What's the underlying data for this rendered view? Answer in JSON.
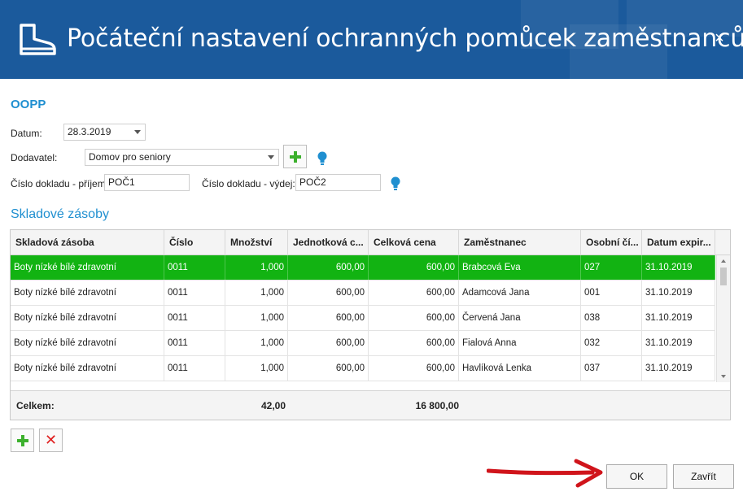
{
  "dialog": {
    "title": "Počáteční nastavení ochranných pomůcek zaměstnancům",
    "close_glyph": "×"
  },
  "oopp": {
    "heading": "OOPP",
    "datum_label": "Datum:",
    "datum_value": "28.3.2019",
    "dodavatel_label": "Dodavatel:",
    "dodavatel_value": "Domov pro seniory",
    "doklad_prijem_label": "Číslo dokladu - příjem:",
    "doklad_prijem_value": "POČ1",
    "doklad_vydej_label": "Číslo dokladu - výdej:",
    "doklad_vydej_value": "POČ2"
  },
  "sklad": {
    "heading": "Skladové zásoby",
    "columns": [
      "Skladová zásoba",
      "Číslo",
      "Množství",
      "Jednotková c...",
      "Celková cena",
      "Zaměstnanec",
      "Osobní čí...",
      "Datum expir..."
    ],
    "rows": [
      {
        "zasoba": "Boty nízké bílé zdravotní",
        "cislo": "0011",
        "mnozstvi": "1,000",
        "jednotkova": "600,00",
        "celkova": "600,00",
        "zamestnanec": "Brabcová Eva",
        "osobni": "027",
        "datum": "31.10.2019",
        "selected": true
      },
      {
        "zasoba": "Boty nízké bílé zdravotní",
        "cislo": "0011",
        "mnozstvi": "1,000",
        "jednotkova": "600,00",
        "celkova": "600,00",
        "zamestnanec": "Adamcová Jana",
        "osobni": "001",
        "datum": "31.10.2019",
        "selected": false
      },
      {
        "zasoba": "Boty nízké bílé zdravotní",
        "cislo": "0011",
        "mnozstvi": "1,000",
        "jednotkova": "600,00",
        "celkova": "600,00",
        "zamestnanec": "Červená Jana",
        "osobni": "038",
        "datum": "31.10.2019",
        "selected": false
      },
      {
        "zasoba": "Boty nízké bílé zdravotní",
        "cislo": "0011",
        "mnozstvi": "1,000",
        "jednotkova": "600,00",
        "celkova": "600,00",
        "zamestnanec": "Fialová Anna",
        "osobni": "032",
        "datum": "31.10.2019",
        "selected": false
      },
      {
        "zasoba": "Boty nízké bílé zdravotní",
        "cislo": "0011",
        "mnozstvi": "1,000",
        "jednotkova": "600,00",
        "celkova": "600,00",
        "zamestnanec": "Havlíková Lenka",
        "osobni": "037",
        "datum": "31.10.2019",
        "selected": false
      }
    ],
    "footer": {
      "label": "Celkem:",
      "mnozstvi_total": "42,00",
      "celkova_total": "16 800,00"
    }
  },
  "buttons": {
    "ok": "OK",
    "close": "Zavřít"
  },
  "icons": {
    "header": "boot-icon",
    "add": "plus-icon",
    "remove": "x-icon",
    "hint": "lightbulb-icon"
  },
  "colors": {
    "header_bg": "#1b5a9c",
    "accent": "#1f8fd0",
    "selected_row": "#12b312",
    "plus": "#3cb02d",
    "remove": "#e02020",
    "arrow": "#d0141b"
  }
}
